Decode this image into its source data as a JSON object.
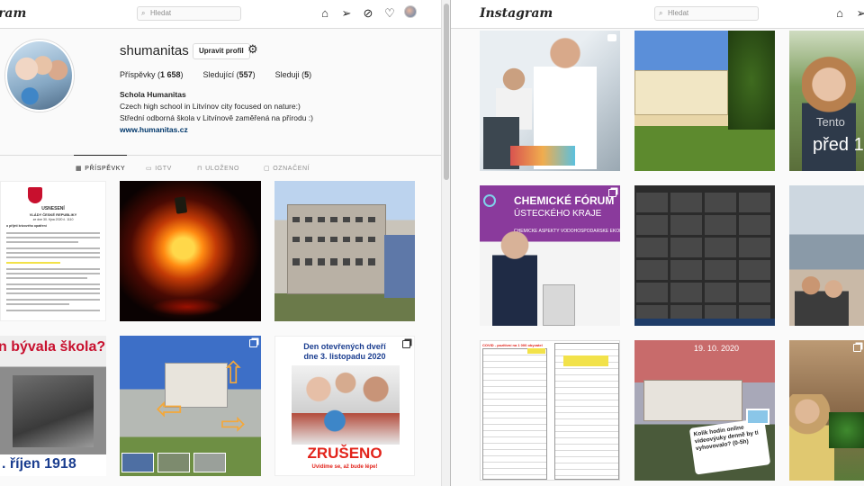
{
  "left": {
    "logo_text": "ram",
    "search_placeholder": "Hledat",
    "profile": {
      "username": "shumanitas",
      "edit_label": "Upravit profil",
      "stats": [
        {
          "label": "Příspěvky",
          "value": "1 658"
        },
        {
          "label": "Sledující",
          "value": "557"
        },
        {
          "label": "Sleduji",
          "value": "5"
        }
      ],
      "bio_name": "Schola Humanitas",
      "bio_line1": "Czech high school in Litvínov city focused on nature:)",
      "bio_line2": "Střední odborná škola v Litvínově zaměřená na přírodu :)",
      "bio_link": "www.humanitas.cz"
    },
    "tabs": [
      {
        "label": "PŘÍSPĚVKY",
        "icon": "grid-icon"
      },
      {
        "label": "IGTV",
        "icon": "igtv-icon"
      },
      {
        "label": "ULOŽENO",
        "icon": "bookmark-icon"
      },
      {
        "label": "OZNAČENÍ",
        "icon": "tagged-icon"
      }
    ],
    "posts": {
      "doc_title1": "USNESENÍ",
      "doc_title2": "VLÁDY ČESKÉ REPUBLIKY",
      "doc_title3": "ze dne 30. října 2020 č. 1110",
      "doc_title4": "o přijetí krizového opatření",
      "history_text1": "n bývala škola?",
      "history_text2": ". říjen 1918",
      "open_day_line1": "Den otevřených dveří",
      "open_day_line2": "dne 3. listopadu 2020",
      "cancelled": "ZRUŠENO",
      "cancelled_sub": "Uvidíme se, až bude lépe!"
    }
  },
  "right": {
    "logo_text": "Instagram",
    "search_placeholder": "Hledat",
    "posts": {
      "story_text1": "Tento",
      "story_text2": "před 1",
      "forum_title1": "CHEMICKÉ FÓRUM",
      "forum_title2": "ÚSTECKÉHO KRAJE",
      "forum_title3": "CHEMICKÉ ASPEKTY VODOHOSPODÁŘSKÉ EKONOMIKY",
      "covid_header": "COVID - pozitivní na 1 000 obyvatel",
      "date_stamp": "19. 10. 2020",
      "survey_text": "Kolik hodin online videovýuky denně by ti vyhovovalo? (0-5h)"
    }
  }
}
